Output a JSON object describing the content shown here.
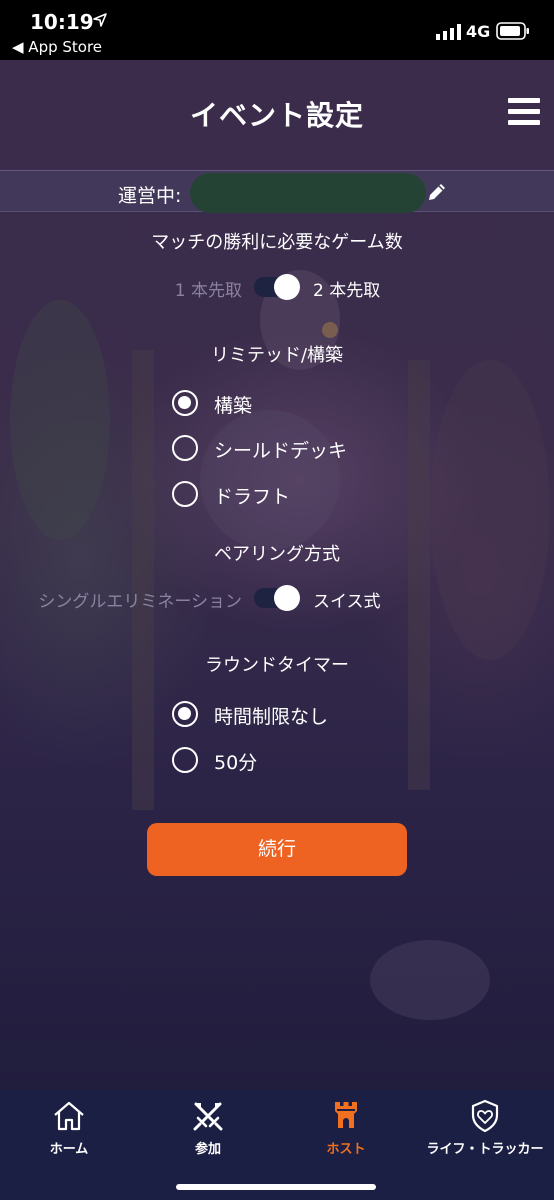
{
  "status_bar": {
    "time": "10:19",
    "back_app": "◀ App Store",
    "network": "4G"
  },
  "header": {
    "title": "イベント設定",
    "menu_icon": "hamburger-menu-icon"
  },
  "organizer": {
    "label": "運営中:",
    "edit_icon": "pencil-icon"
  },
  "match_wins": {
    "label": "マッチの勝利に必要なゲーム数",
    "toggle_left": "1 本先取",
    "toggle_right": "2 本先取",
    "toggle_on": true
  },
  "format": {
    "label": "リミテッド/構築",
    "options": [
      {
        "label": "構築",
        "checked": true
      },
      {
        "label": "シールドデッキ",
        "checked": false
      },
      {
        "label": "ドラフト",
        "checked": false
      }
    ]
  },
  "pairing": {
    "label": "ペアリング方式",
    "toggle_left": "シングルエリミネーション",
    "toggle_right": "スイス式",
    "toggle_on": true
  },
  "round_timer": {
    "label": "ラウンドタイマー",
    "options": [
      {
        "label": "時間制限なし",
        "checked": true
      },
      {
        "label": "50分",
        "checked": false
      }
    ]
  },
  "continue_button": "続行",
  "tabs": [
    {
      "label": "ホーム",
      "icon": "house-icon",
      "active": false
    },
    {
      "label": "参加",
      "icon": "crossed-swords-icon",
      "active": false
    },
    {
      "label": "ホスト",
      "icon": "castle-tower-icon",
      "active": true
    },
    {
      "label": "ライフ・トラッカー",
      "icon": "shield-heart-icon",
      "active": false
    }
  ],
  "colors": {
    "accent": "#ef6322",
    "tab_active": "#f07020",
    "tab_bar": "#1c1f44",
    "toggle_track": "#1d2340"
  }
}
